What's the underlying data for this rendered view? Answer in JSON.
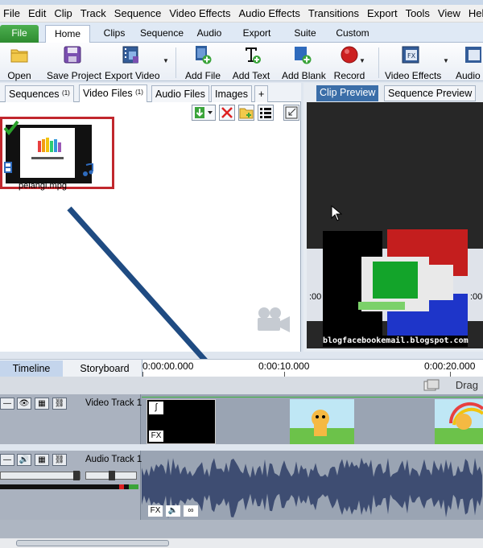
{
  "menu": [
    "File",
    "Edit",
    "Clip",
    "Track",
    "Sequence",
    "Video Effects",
    "Audio Effects",
    "Transitions",
    "Export",
    "Tools",
    "View",
    "Help"
  ],
  "ribbon_tabs": {
    "file": "File",
    "tabs": [
      "Home",
      "Clips",
      "Sequence",
      "Audio",
      "Export",
      "Suite",
      "Custom"
    ],
    "active": "Home"
  },
  "toolbar": {
    "open": "Open",
    "save_project": "Save Project",
    "export_video": "Export Video",
    "add_file": "Add File",
    "add_text": "Add Text",
    "add_blank": "Add Blank",
    "record": "Record",
    "video_effects": "Video Effects",
    "audio_effects": "Audio Effects"
  },
  "media_tabs": {
    "sequences": "Sequences",
    "sequences_count": "(1)",
    "video_files": "Video Files",
    "video_files_count": "(1)",
    "audio_files": "Audio Files",
    "images": "Images",
    "add": "+"
  },
  "media_items": [
    {
      "name": "pelangi.mpg"
    }
  ],
  "preview_tabs": {
    "clip": "Clip Preview",
    "sequence": "Sequence Preview"
  },
  "watermark": "blogfacebookemail.blogspot.com",
  "preview_time": ":00",
  "timeline": {
    "tab_timeline": "Timeline",
    "tab_storyboard": "Storyboard",
    "ruler": [
      "0:00:00.000",
      "0:00:10.000",
      "0:00:20.000"
    ],
    "drag_hint": "Drag",
    "video_track": "Video Track 1",
    "audio_track": "Audio Track 1",
    "fx": "FX"
  },
  "colors": {
    "accent": "#3b6ea8",
    "highlight_box": "#c1272d",
    "arrow": "#1f4b82",
    "waveform": "#3e4d72"
  }
}
